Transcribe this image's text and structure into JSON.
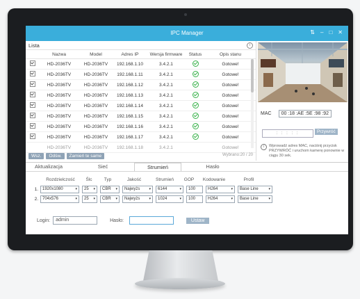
{
  "window": {
    "title": "IPC Manager",
    "controls": [
      "⇅",
      "–",
      "□",
      "✕"
    ]
  },
  "list": {
    "label": "Lista",
    "columns": [
      "",
      "Nazwa",
      "Model",
      "Adres IP",
      "Wersja firmware",
      "Status",
      "Opis stanu"
    ],
    "rows": [
      {
        "name": "HD-2036TV",
        "model": "HD-2036TV",
        "ip": "192.168.1.10",
        "fw": "3.4.2.1",
        "desc": "Gotowe!"
      },
      {
        "name": "HD-2036TV",
        "model": "HD-2036TV",
        "ip": "192.168.1.11",
        "fw": "3.4.2.1",
        "desc": "Gotowe!"
      },
      {
        "name": "HD-2036TV",
        "model": "HD-2036TV",
        "ip": "192.168.1.12",
        "fw": "3.4.2.1",
        "desc": "Gotowe!"
      },
      {
        "name": "HD-2036TV",
        "model": "HD-2036TV",
        "ip": "192.168.1.13",
        "fw": "3.4.2.1",
        "desc": "Gotowe!"
      },
      {
        "name": "HD-2036TV",
        "model": "HD-2036TV",
        "ip": "192.168.1.14",
        "fw": "3.4.2.1",
        "desc": "Gotowe!"
      },
      {
        "name": "HD-2036TV",
        "model": "HD-2036TV",
        "ip": "192.168.1.15",
        "fw": "3.4.2.1",
        "desc": "Gotowe!"
      },
      {
        "name": "HD-2036TV",
        "model": "HD-2036TV",
        "ip": "192.168.1.16",
        "fw": "3.4.2.1",
        "desc": "Gotowe!"
      },
      {
        "name": "HD-2036TV",
        "model": "HD-2036TV",
        "ip": "192.168.1.17",
        "fw": "3.4.2.1",
        "desc": "Gotowe!"
      }
    ],
    "partial_row": {
      "name": "HD-2036TV",
      "model": "HD-2036TV",
      "ip": "192.168.1.18",
      "fw": "3.4.2.1",
      "desc": "Gotowe!"
    },
    "buttons": {
      "search": "Wsz.",
      "refresh": "Odśw.",
      "replace": "Zamień te same"
    },
    "selected": "Wybrano:20 / 20"
  },
  "side": {
    "mac_label": "MAC",
    "mac_value": "00 :18 :AE :5E :98 :92",
    "mac_input": ": : : : :",
    "restore_btn": "Przywróć",
    "note_icon": "i",
    "note": "Wprowadź adres MAC, naciśnij przycisk PRZYWRÓĆ i uruchom kamerę ponownie w ciągu 30 sek."
  },
  "tabs": [
    "Aktualizacja",
    "Sieć",
    "Strumień",
    "Hasło"
  ],
  "stream": {
    "headers": [
      "Rozdzielczość",
      "Ślc",
      "Typ",
      "Jakość",
      "Strumień",
      "GOP",
      "Kodowanie",
      "Profil"
    ],
    "rows": [
      {
        "num": "1.",
        "res": "1920x1080",
        "fps": "25",
        "type": "CBR",
        "quality": "Najwyżs",
        "bitrate": "6144",
        "gop": "100",
        "codec": "H264",
        "profile": "Base Line"
      },
      {
        "num": "2.",
        "res": "704x576",
        "fps": "25",
        "type": "CBR",
        "quality": "Najwyżs",
        "bitrate": "1024",
        "gop": "100",
        "codec": "H264",
        "profile": "Base Line"
      }
    ]
  },
  "login": {
    "login_label": "Login:",
    "login_value": "admin",
    "password_label": "Hasło:",
    "password_value": "",
    "save_btn": "Ustaw"
  }
}
